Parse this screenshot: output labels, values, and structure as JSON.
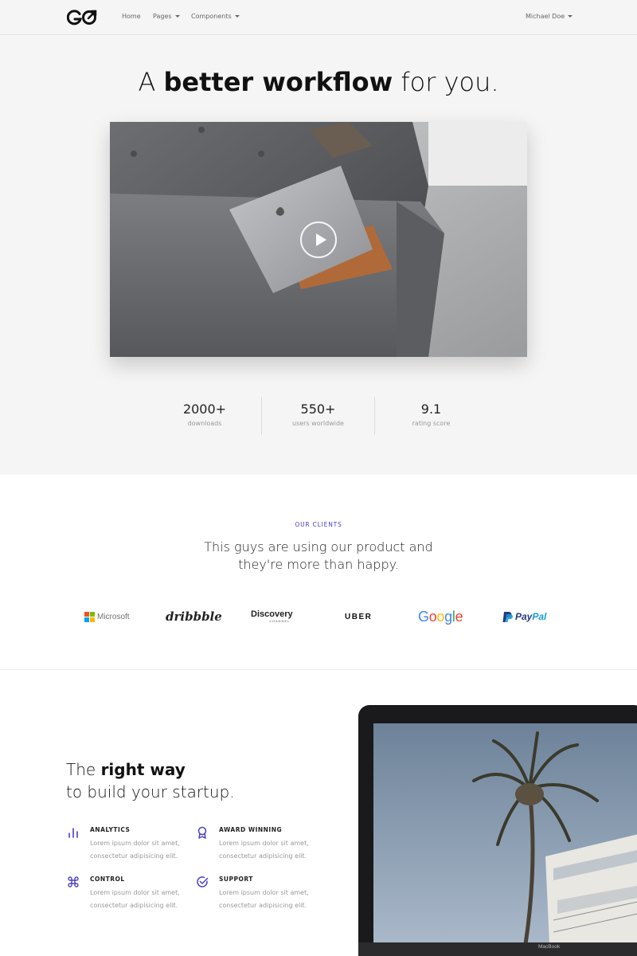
{
  "nav": {
    "logo": "GO",
    "links": [
      {
        "label": "Home",
        "dropdown": false
      },
      {
        "label": "Pages",
        "dropdown": true
      },
      {
        "label": "Components",
        "dropdown": true
      }
    ],
    "user": "Michael Doe"
  },
  "hero": {
    "title_pre": "A ",
    "title_bold": "better workflow",
    "title_post": " for you.",
    "stats": [
      {
        "value": "2000+",
        "label": "downloads"
      },
      {
        "value": "550+",
        "label": "users worldwide"
      },
      {
        "value": "9.1",
        "label": "rating score"
      }
    ]
  },
  "clients": {
    "eyebrow": "OUR CLIENTS",
    "title_line1": "This guys are using our product and",
    "title_line2": "they're more than happy.",
    "logos": [
      "Microsoft",
      "dribbble",
      "Discovery",
      "UBER",
      "Google",
      "PayPal"
    ],
    "discovery_sub": "CHANNEL"
  },
  "features": {
    "title_pre": "The ",
    "title_bold": "right way",
    "title_line2": "to build your startup.",
    "items": [
      {
        "name": "ANALYTICS",
        "desc": "Lorem ipsum dolor sit amet, consectetur adipisicing elit.",
        "icon": "bar-chart-icon"
      },
      {
        "name": "AWARD WINNING",
        "desc": "Lorem ipsum dolor sit amet, consectetur adipisicing elit.",
        "icon": "award-icon"
      },
      {
        "name": "CONTROL",
        "desc": "Lorem ipsum dolor sit amet, consectetur adipisicing elit.",
        "icon": "command-icon"
      },
      {
        "name": "SUPPORT",
        "desc": "Lorem ipsum dolor sit amet, consectetur adipisicing elit.",
        "icon": "check-circle-icon"
      }
    ],
    "laptop_label": "MacBook"
  },
  "colors": {
    "accent": "#4b3fc4",
    "hero_bg": "#f5f5f5",
    "google_blue": "#4285f4",
    "google_red": "#ea4335",
    "google_yellow": "#fbbc05",
    "google_green": "#34a853",
    "paypal_dark": "#253b80",
    "paypal_light": "#179bd7"
  }
}
